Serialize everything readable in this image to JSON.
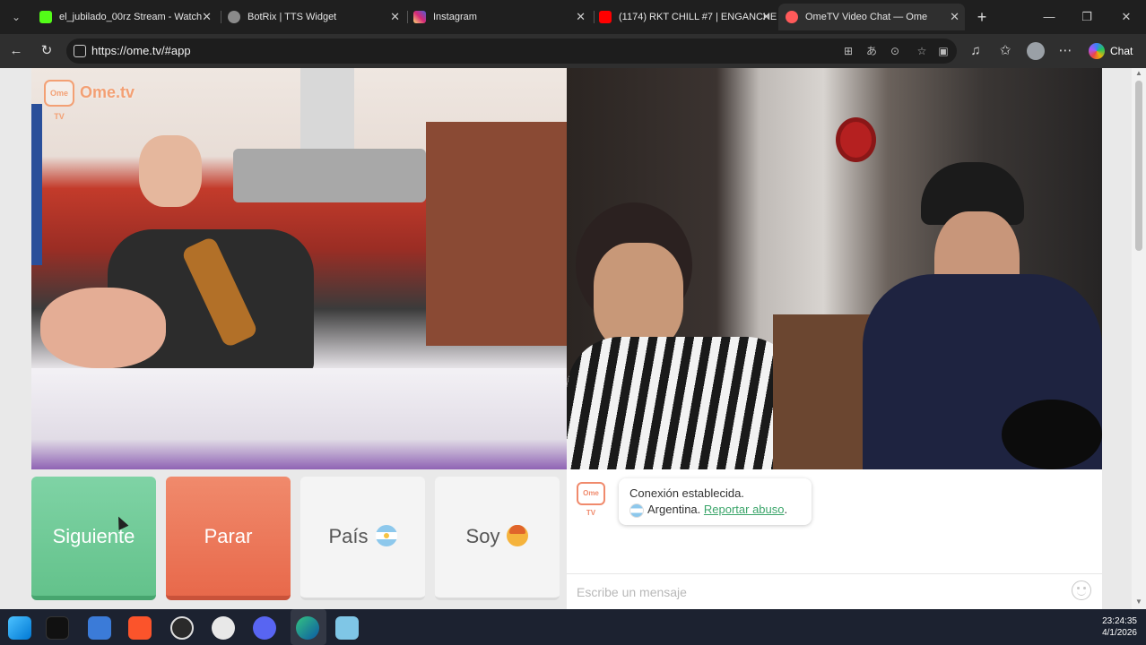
{
  "browser": {
    "tabs": [
      {
        "title": "el_jubilado_00rz Stream - Watch",
        "favicon": "kick-icon",
        "color": "#53fc18",
        "active": false
      },
      {
        "title": "BotRix | TTS Widget",
        "favicon": "botrix-icon",
        "color": "#8a8a8a",
        "active": false
      },
      {
        "title": "Instagram",
        "favicon": "instagram-icon",
        "color": "#d62976",
        "active": false
      },
      {
        "title": "(1174) RKT CHILL #7 | ENGANCHE",
        "favicon": "youtube-icon",
        "color": "#ff0000",
        "active": false
      },
      {
        "title": "OmeTV Video Chat — Ome",
        "favicon": "ometv-icon",
        "color": "#ff5a5a",
        "active": true
      }
    ],
    "url": "https://ome.tv/#app",
    "chat_label": "Chat"
  },
  "app": {
    "logo_badge": "Ome TV",
    "logo_text": "Ome.tv",
    "buttons": {
      "next": "Siguiente",
      "stop": "Parar",
      "country": "País",
      "me": "Soy"
    },
    "chat": {
      "logo_badge": "Ome TV",
      "status": "Conexión establecida.",
      "country": "Argentina.",
      "report": "Reportar abuso",
      "report_suffix": ".",
      "input_placeholder": "Escribe un mensaje"
    }
  },
  "taskbar": {
    "apps": [
      "windows-start-icon",
      "tiktok-icon",
      "files-icon",
      "brave-icon",
      "obs-icon",
      "chatgpt-icon",
      "discord-icon",
      "edge-icon",
      "notepad-icon"
    ],
    "time": "23:24:35",
    "date": "4/1/2026"
  }
}
